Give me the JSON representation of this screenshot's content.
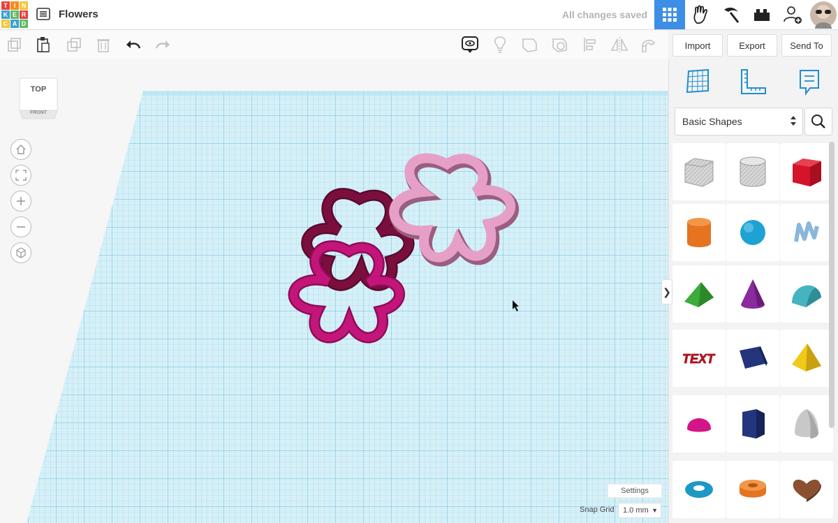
{
  "app": {
    "logo_letters": [
      "T",
      "I",
      "N",
      "K",
      "E",
      "R",
      "C",
      "A",
      "D"
    ],
    "logo_colors": [
      "#e8403c",
      "#f48b21",
      "#f5c43a",
      "#3c9fd6",
      "#5dbb63",
      "#e8403c",
      "#f5c43a",
      "#3c9fd6",
      "#5dbb63"
    ],
    "design_title": "Flowers",
    "save_status": "All changes saved"
  },
  "topbar_icons": [
    "grid-view-icon",
    "tinker-hand-icon",
    "pickaxe-icon",
    "blocks-icon",
    "user-add-icon",
    "avatar"
  ],
  "toolbar": {
    "left_tools": [
      "copy-icon",
      "paste-icon",
      "duplicate-icon",
      "delete-icon",
      "undo-icon",
      "redo-icon"
    ],
    "right_tools": [
      "notes-icon",
      "light-bulb-icon",
      "shape-outline-icon",
      "hole-icon",
      "align-icon",
      "mirror-icon",
      "magnet-icon"
    ]
  },
  "actions": {
    "import_label": "Import",
    "export_label": "Export",
    "sendto_label": "Send To"
  },
  "viewcube": {
    "top_label": "TOP",
    "front_label": "FRONT"
  },
  "nav_controls": [
    "home-icon",
    "fit-view-icon",
    "zoom-in-icon",
    "zoom-out-icon",
    "perspective-icon"
  ],
  "panel": {
    "tabs": [
      "workplane-icon",
      "ruler-icon",
      "notes-tab-icon"
    ],
    "library_select": "Basic Shapes",
    "shapes": [
      {
        "name": "box-hole",
        "color": "#c8c8c8"
      },
      {
        "name": "cylinder-hole",
        "color": "#c8c8c8"
      },
      {
        "name": "box",
        "color": "#d4142a"
      },
      {
        "name": "cylinder",
        "color": "#e5731f"
      },
      {
        "name": "sphere",
        "color": "#1ea2d4"
      },
      {
        "name": "scribble",
        "color": "#8ab6d9"
      },
      {
        "name": "roof",
        "color": "#3cab3c"
      },
      {
        "name": "cone",
        "color": "#8b2a9c"
      },
      {
        "name": "round-roof",
        "color": "#46b4c0"
      },
      {
        "name": "text",
        "color": "#cc1122"
      },
      {
        "name": "wedge",
        "color": "#24357d"
      },
      {
        "name": "pyramid",
        "color": "#f2c81a"
      },
      {
        "name": "half-sphere",
        "color": "#d41587"
      },
      {
        "name": "polygon",
        "color": "#24357d"
      },
      {
        "name": "paraboloid",
        "color": "#c8c8c8"
      },
      {
        "name": "torus",
        "color": "#1e98c4"
      },
      {
        "name": "tube",
        "color": "#e5731f"
      },
      {
        "name": "heart",
        "color": "#8a5030"
      }
    ]
  },
  "footer": {
    "settings_label": "Settings",
    "snap_label": "Snap Grid",
    "snap_value": "1.0 mm"
  },
  "flowers": [
    {
      "name": "dark-flower",
      "color": "#7a0f3e"
    },
    {
      "name": "magenta-flower",
      "color": "#c4157a"
    },
    {
      "name": "pink-flower",
      "color": "#e6a0c8"
    }
  ]
}
